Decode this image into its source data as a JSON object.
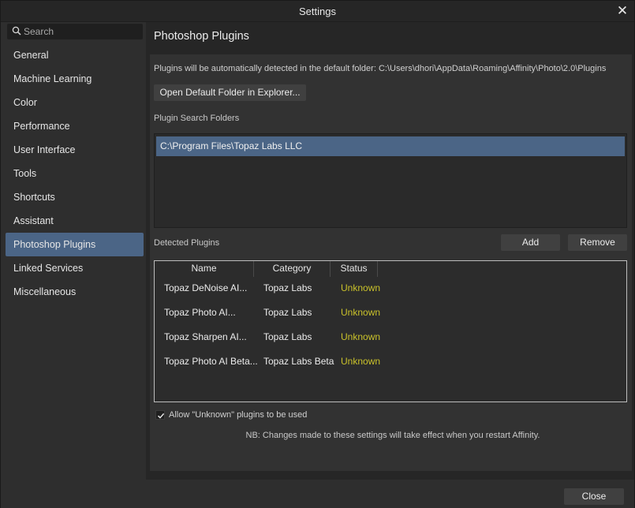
{
  "window": {
    "title": "Settings"
  },
  "search": {
    "placeholder": "Search",
    "value": ""
  },
  "sidebar": {
    "items": [
      {
        "label": "General",
        "active": false
      },
      {
        "label": "Machine Learning",
        "active": false
      },
      {
        "label": "Color",
        "active": false
      },
      {
        "label": "Performance",
        "active": false
      },
      {
        "label": "User Interface",
        "active": false
      },
      {
        "label": "Tools",
        "active": false
      },
      {
        "label": "Shortcuts",
        "active": false
      },
      {
        "label": "Assistant",
        "active": false
      },
      {
        "label": "Photoshop Plugins",
        "active": true
      },
      {
        "label": "Linked Services",
        "active": false
      },
      {
        "label": "Miscellaneous",
        "active": false
      }
    ]
  },
  "main": {
    "title": "Photoshop Plugins",
    "info_text": "Plugins will be automatically detected in the default folder: C:\\Users\\dhori\\AppData\\Roaming\\Affinity\\Photo\\2.0\\Plugins",
    "open_folder_label": "Open Default Folder in Explorer...",
    "search_folders_label": "Plugin Search Folders",
    "search_folders": [
      "C:\\Program Files\\Topaz Labs LLC"
    ],
    "detected_label": "Detected Plugins",
    "add_label": "Add",
    "remove_label": "Remove",
    "table": {
      "columns": [
        "Name",
        "Category",
        "Status"
      ],
      "rows": [
        {
          "name": "Topaz DeNoise AI...",
          "category": "Topaz Labs",
          "status": "Unknown"
        },
        {
          "name": "Topaz Photo AI...",
          "category": "Topaz Labs",
          "status": "Unknown"
        },
        {
          "name": "Topaz Sharpen AI...",
          "category": "Topaz Labs",
          "status": "Unknown"
        },
        {
          "name": "Topaz Photo AI Beta...",
          "category": "Topaz Labs Beta",
          "status": "Unknown"
        }
      ]
    },
    "allow_unknown_label": "Allow \"Unknown\" plugins to be used",
    "allow_unknown_checked": true,
    "note": "NB: Changes made to these settings will take effect when you restart Affinity."
  },
  "footer": {
    "close_label": "Close"
  },
  "colors": {
    "accent": "#4b6586",
    "status_unknown": "#c9c12a"
  },
  "icons": {
    "search": "search-icon",
    "close": "close-icon",
    "check": "checkmark-icon"
  }
}
